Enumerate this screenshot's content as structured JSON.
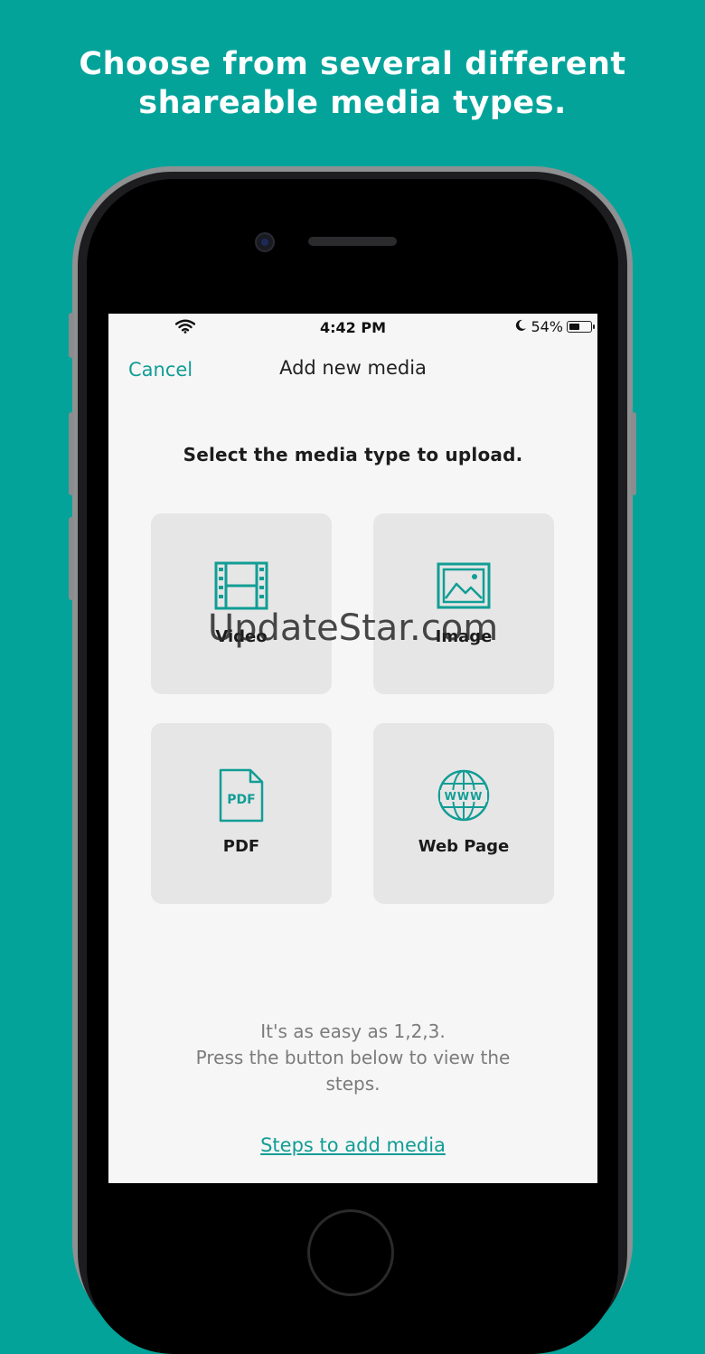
{
  "headline": {
    "line1": "Choose from several different",
    "line2": "shareable media types."
  },
  "status_bar": {
    "time": "4:42 PM",
    "battery_text": "54%",
    "battery_level": 0.54,
    "icons": [
      "wifi-icon",
      "moon-icon",
      "battery-icon"
    ]
  },
  "nav": {
    "cancel_label": "Cancel",
    "title": "Add new media"
  },
  "instruction": "Select the media type to upload.",
  "media_types": [
    {
      "label": "Video",
      "icon": "film-icon"
    },
    {
      "label": "Image",
      "icon": "image-icon"
    },
    {
      "label": "PDF",
      "icon": "pdf-icon"
    },
    {
      "label": "Web Page",
      "icon": "globe-icon"
    }
  ],
  "pdf_icon_text": "PDF",
  "web_icon_text": "WWW",
  "helper": {
    "line1": "It's as easy as 1,2,3.",
    "line2": "Press the button below to view the",
    "line3": "steps."
  },
  "steps_link": "Steps to add media",
  "watermark": "UpdateStar.com",
  "colors": {
    "background": "#03a39a",
    "accent": "#129d95",
    "tile": "#e6e6e6",
    "screen": "#f6f6f6"
  }
}
